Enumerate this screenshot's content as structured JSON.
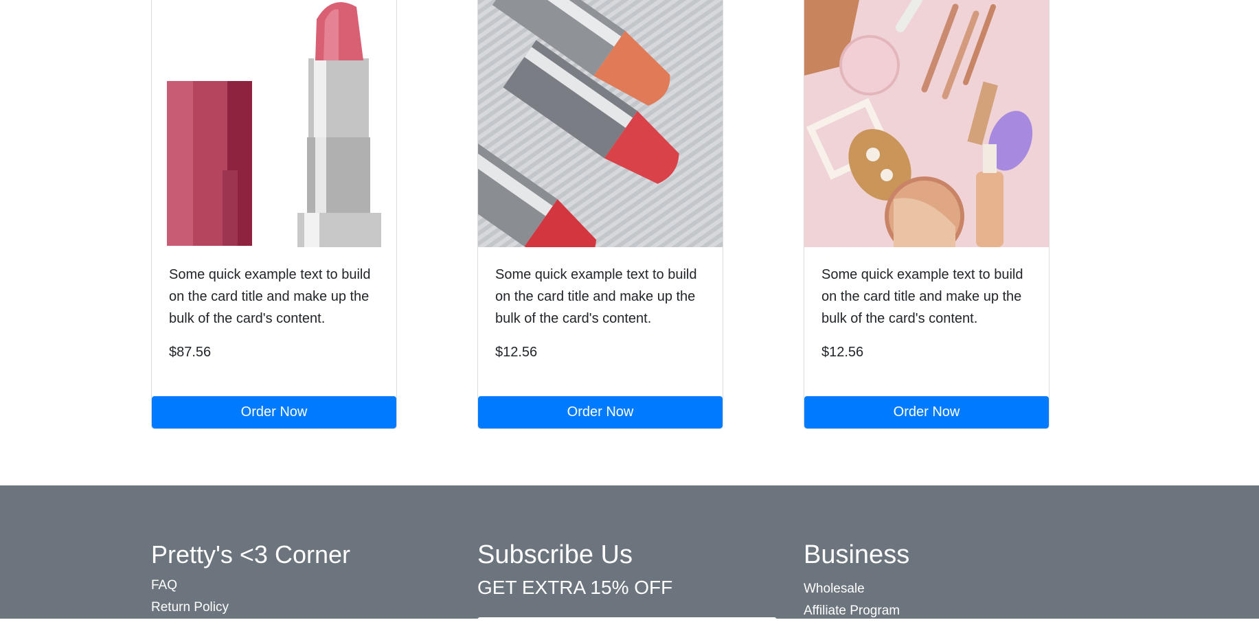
{
  "products": [
    {
      "image": "lipstick-open-image",
      "description": "Some quick example text to build on the card title and make up the bulk of the card's content.",
      "price": "$87.56",
      "button": "Order Now"
    },
    {
      "image": "lipsticks-trio-image",
      "description": "Some quick example text to build on the card title and make up the bulk of the card's content.",
      "price": "$12.56",
      "button": "Order Now"
    },
    {
      "image": "makeup-flatlay-image",
      "description": "Some quick example text to build on the card title and make up the bulk of the card's content.",
      "price": "$12.56",
      "button": "Order Now"
    }
  ],
  "footer": {
    "brand": {
      "title": "Pretty's <3 Corner",
      "links": [
        "FAQ",
        "Return Policy"
      ]
    },
    "subscribe": {
      "title": "Subscribe Us",
      "offer": "GET EXTRA 15% OFF"
    },
    "business": {
      "title": "Business",
      "links": [
        "Wholesale",
        "Affiliate Program"
      ]
    }
  },
  "colors": {
    "primary": "#007bff",
    "footer_bg": "#6c757d"
  }
}
